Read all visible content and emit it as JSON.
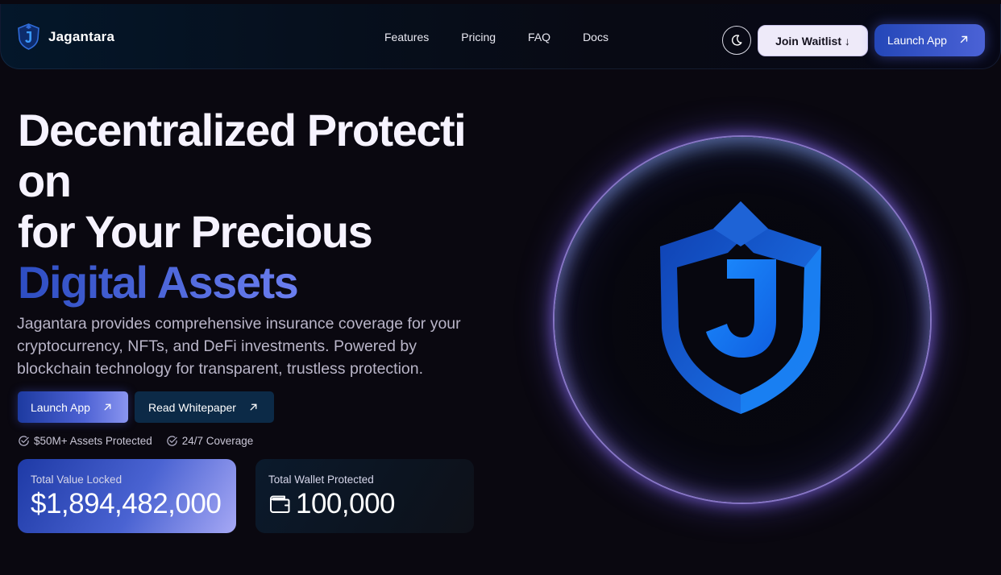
{
  "nav": {
    "brand": "Jagantara",
    "links": [
      "Features",
      "Pricing",
      "FAQ",
      "Docs"
    ],
    "theme_icon": "moon-icon",
    "join_waitlist": "Join Waitlist ↓",
    "launch_app": "Launch App"
  },
  "hero": {
    "title_line1": "Decentralized Protecti",
    "title_line2": "on",
    "title_line3": "for Your Precious",
    "title_accent": "Digital Assets",
    "description": "Jagantara provides comprehensive insurance coverage for your cryptocurrency, NFTs, and DeFi investments. Powered by blockchain technology for transparent, trustless protection.",
    "primary_button": "Launch App",
    "secondary_button": "Read Whitepaper",
    "badges": [
      "$50M+ Assets Protected",
      "24/7 Coverage"
    ]
  },
  "stats": {
    "tvl_label": "Total Value Locked",
    "tvl_value": "$1,894,482,000",
    "wallet_label": "Total Wallet Protected",
    "wallet_value": "100,000",
    "wallet_icon": "wallet-icon"
  },
  "colors": {
    "background": "#0a0810",
    "accent_blue": "#2447b8",
    "accent_purple": "#8f8ff5",
    "shield_blue": "#1a8cff"
  }
}
